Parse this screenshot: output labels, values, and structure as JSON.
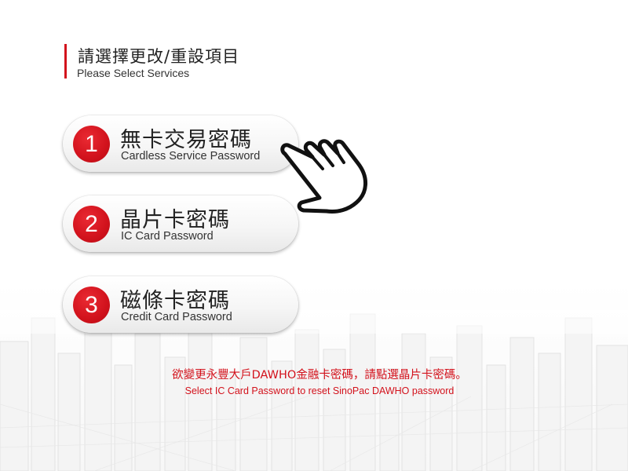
{
  "header": {
    "title_zh": "請選擇更改/重設項目",
    "title_en": "Please Select Services"
  },
  "options": [
    {
      "number": "1",
      "label_zh": "無卡交易密碼",
      "label_en": "Cardless Service Password"
    },
    {
      "number": "2",
      "label_zh": "晶片卡密碼",
      "label_en": "IC Card Password"
    },
    {
      "number": "3",
      "label_zh": "磁條卡密碼",
      "label_en": "Credit Card Password"
    }
  ],
  "notice": {
    "text_zh": "欲變更永豐大戶DAWHO金融卡密碼，請點選晶片卡密碼。",
    "text_en": "Select IC Card Password to reset SinoPac DAWHO password"
  },
  "icons": {
    "pointer": "pointing-hand-icon"
  },
  "colors": {
    "accent": "#d3121c",
    "text": "#222222",
    "background": "#ffffff"
  }
}
